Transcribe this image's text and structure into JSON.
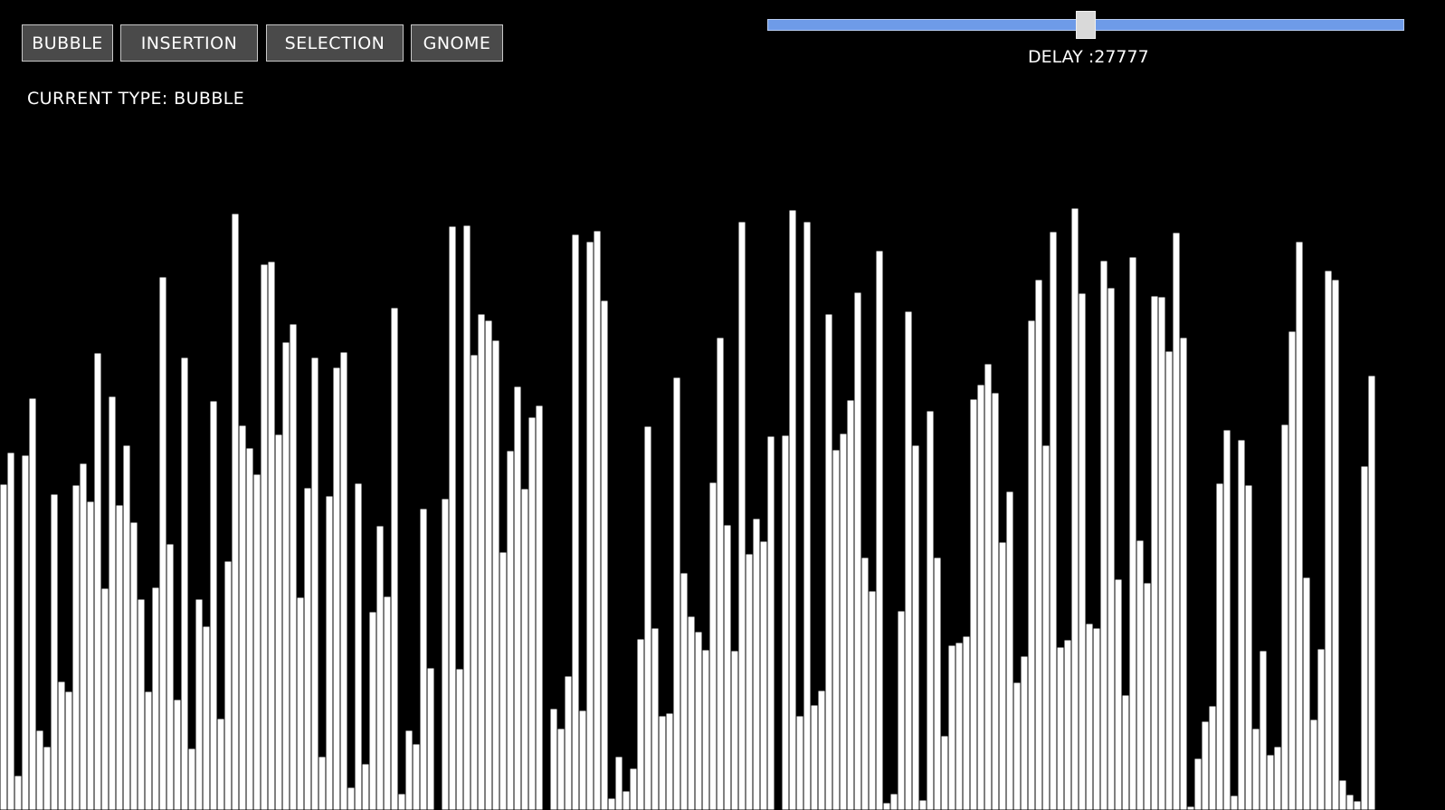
{
  "toolbar": {
    "buttons": [
      {
        "id": "bubble",
        "label": "BUBBLE"
      },
      {
        "id": "insertion",
        "label": "INSERTION"
      },
      {
        "id": "selection",
        "label": "SELECTION"
      },
      {
        "id": "gnome",
        "label": "GNOME"
      }
    ]
  },
  "status": {
    "current_type": "CURRENT TYPE: BUBBLE"
  },
  "delay": {
    "label": "DELAY :27777",
    "slider_fraction": 0.5
  },
  "colors": {
    "background": "#000000",
    "bar": "#ffffff",
    "slider_track": "#6e9be8",
    "button_bg": "#4a4a4a"
  },
  "array_values": [
    360,
    395,
    38,
    392,
    455,
    88,
    70,
    349,
    142,
    131,
    359,
    383,
    341,
    505,
    245,
    457,
    337,
    403,
    318,
    233,
    131,
    246,
    589,
    294,
    122,
    500,
    68,
    233,
    203,
    452,
    101,
    275,
    659,
    425,
    400,
    371,
    603,
    606,
    415,
    517,
    537,
    235,
    356,
    500,
    59,
    347,
    489,
    506,
    25,
    361,
    51,
    219,
    314,
    236,
    555,
    18,
    88,
    73,
    333,
    157,
    0,
    344,
    645,
    156,
    646,
    503,
    548,
    541,
    519,
    285,
    397,
    468,
    355,
    434,
    447,
    0,
    112,
    90,
    148,
    636,
    110,
    628,
    640,
    563,
    13,
    59,
    21,
    46,
    189,
    424,
    201,
    104,
    107,
    478,
    262,
    214,
    197,
    177,
    362,
    522,
    315,
    176,
    650,
    283,
    322,
    297,
    413,
    0,
    414,
    663,
    104,
    650,
    116,
    132,
    548,
    398,
    416,
    453,
    572,
    279,
    242,
    618,
    8,
    18,
    220,
    551,
    403,
    11,
    441,
    279,
    82,
    182,
    185,
    192,
    454,
    470,
    493,
    461,
    296,
    352,
    141,
    170,
    541,
    586,
    403,
    639,
    180,
    188,
    665,
    571,
    206,
    201,
    607,
    577,
    255,
    127,
    611,
    298,
    251,
    568,
    567,
    507,
    638,
    522,
    4,
    57,
    98,
    115,
    361,
    420,
    16,
    409,
    359,
    90,
    176,
    61,
    70,
    426,
    529,
    628,
    257,
    100,
    178,
    596,
    586,
    33,
    17,
    10,
    380,
    480,
    0,
    0,
    0,
    0,
    0,
    0,
    0,
    0,
    0,
    0
  ]
}
